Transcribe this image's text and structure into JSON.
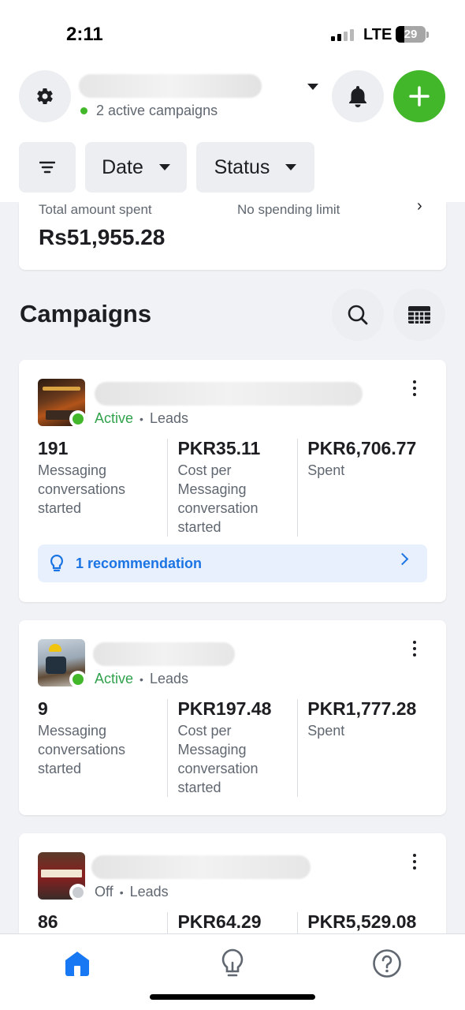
{
  "status_bar": {
    "time": "2:11",
    "network": "LTE",
    "battery": "29",
    "battery_level": 0.29
  },
  "header": {
    "account_caption": "2 active campaigns"
  },
  "filters": {
    "date_label": "Date",
    "status_label": "Status"
  },
  "summary": {
    "spent_label": "Total amount spent",
    "spent_value": "Rs51,955.28",
    "limit_label": "No spending limit"
  },
  "campaigns_section": {
    "title": "Campaigns"
  },
  "campaigns": [
    {
      "status": "Active",
      "objective": "Leads",
      "status_color": "#31a24c",
      "metrics": [
        {
          "value": "191",
          "label": "Messaging conversations started"
        },
        {
          "value": "PKR35.11",
          "label": "Cost per Messaging conversation started"
        },
        {
          "value": "PKR6,706.77",
          "label": "Spent"
        }
      ],
      "recommendation": "1 recommendation"
    },
    {
      "status": "Active",
      "objective": "Leads",
      "status_color": "#31a24c",
      "metrics": [
        {
          "value": "9",
          "label": "Messaging conversations started"
        },
        {
          "value": "PKR197.48",
          "label": "Cost per Messaging conversation started"
        },
        {
          "value": "PKR1,777.28",
          "label": "Spent"
        }
      ]
    },
    {
      "status": "Off",
      "objective": "Leads",
      "status_color": "#c9ccd1",
      "metrics": [
        {
          "value": "86",
          "label": ""
        },
        {
          "value": "PKR64.29",
          "label": ""
        },
        {
          "value": "PKR5,529.08",
          "label": ""
        }
      ]
    }
  ],
  "colors": {
    "brand_blue": "#1877f2",
    "create_green": "#42b72a",
    "active_green": "#31a24c"
  },
  "bottom_nav": [
    "home-icon",
    "lightbulb-icon",
    "help-icon"
  ]
}
